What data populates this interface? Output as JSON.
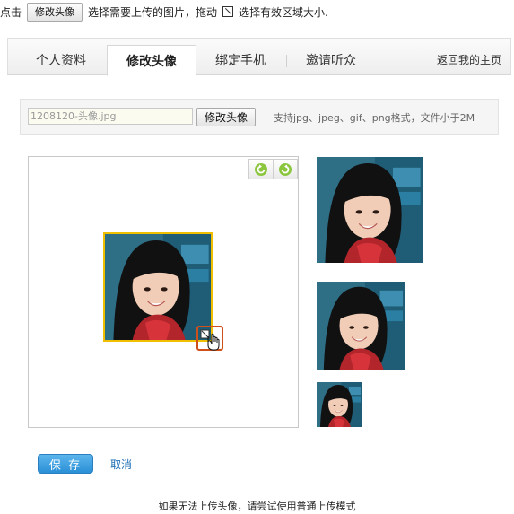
{
  "instruction": {
    "prefix": "点击",
    "button_label": "修改头像",
    "middle": "选择需要上传的图片，拖动",
    "suffix": "选择有效区域大小."
  },
  "tabs": [
    {
      "label": "个人资料",
      "active": false
    },
    {
      "label": "修改头像",
      "active": true
    },
    {
      "label": "绑定手机",
      "active": false
    },
    {
      "label": "邀请听众",
      "active": false
    }
  ],
  "back_link": "返回我的主页",
  "upload": {
    "file_value": "1208120-头像.jpg",
    "button_label": "修改头像",
    "formats_text": "支持jpg、jpeg、gif、png格式，文件小于2M"
  },
  "editor": {
    "rotate_left_icon": "rotate-left-icon",
    "rotate_right_icon": "rotate-right-icon"
  },
  "actions": {
    "save_label": "保 存",
    "cancel_label": "取消"
  },
  "footer_note": "如果无法上传头像，请尝试使用普通上传模式",
  "colors": {
    "accent_blue": "#2a8fd6",
    "crop_border": "#f0c000",
    "handle_border": "#d0501c",
    "link": "#1f6fb5"
  }
}
